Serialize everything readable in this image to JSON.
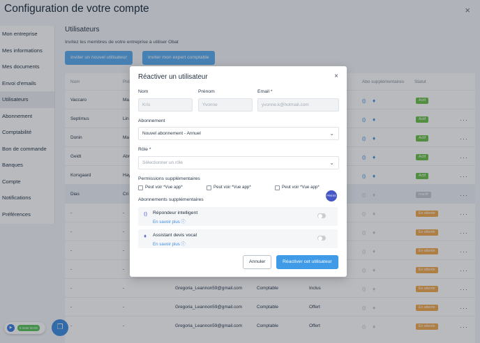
{
  "page": {
    "title": "Configuration de votre compte",
    "close": "×"
  },
  "sidebar": {
    "items": [
      {
        "label": "Mon entreprise"
      },
      {
        "label": "Mes informations"
      },
      {
        "label": "Mes documents"
      },
      {
        "label": "Envoi d'emails"
      },
      {
        "label": "Utilisateurs"
      },
      {
        "label": "Abonnement"
      },
      {
        "label": "Comptabilité"
      },
      {
        "label": "Bon de commande"
      },
      {
        "label": "Banques"
      },
      {
        "label": "Compte"
      },
      {
        "label": "Notifications"
      },
      {
        "label": "Préférences"
      }
    ],
    "active_index": 4
  },
  "users_section": {
    "title": "Utilisateurs",
    "subtitle": "Invitez les membres de votre entreprise à utiliser Obat",
    "invite_user_label": "Inviter un nouvel utilisateur",
    "invite_expert_label": "Inviter mon expert comptable"
  },
  "table": {
    "headers": {
      "nom": "Nom",
      "prenom": "Pré",
      "abo": "Abo supplémentaires",
      "statut": "Statut"
    },
    "rows": [
      {
        "nom": "Vaccaro",
        "prenom": "Ma",
        "email": "",
        "role": "",
        "abo": "",
        "statut": "Actif"
      },
      {
        "nom": "Septimus",
        "prenom": "Lin",
        "email": "",
        "role": "",
        "abo": "",
        "statut": "Actif"
      },
      {
        "nom": "Donin",
        "prenom": "Ma",
        "email": "",
        "role": "",
        "abo": "",
        "statut": "Actif"
      },
      {
        "nom": "Geidt",
        "prenom": "Abr",
        "email": "",
        "role": "",
        "abo": "",
        "statut": "Actif"
      },
      {
        "nom": "Korsgaard",
        "prenom": "Hay",
        "email": "",
        "role": "",
        "abo": "",
        "statut": "Actif"
      },
      {
        "nom": "Dias",
        "prenom": "Cri",
        "email": "",
        "role": "",
        "abo": "",
        "statut": "Inactif"
      },
      {
        "nom": "-",
        "prenom": "-",
        "email": "",
        "role": "",
        "abo": "",
        "statut": "En attente"
      },
      {
        "nom": "-",
        "prenom": "-",
        "email": "",
        "role": "",
        "abo": "",
        "statut": "En attente"
      },
      {
        "nom": "-",
        "prenom": "-",
        "email": "",
        "role": "",
        "abo": "",
        "statut": "En attente"
      },
      {
        "nom": "-",
        "prenom": "-",
        "email": "",
        "role": "",
        "abo": "",
        "statut": "En attente"
      },
      {
        "nom": "-",
        "prenom": "-",
        "email": "Gregoria_Leannon59@gmail.com",
        "role": "Comptable",
        "abo": "Inclus",
        "statut": "En attente"
      },
      {
        "nom": "-",
        "prenom": "-",
        "email": "Gregoria_Leannon59@gmail.com",
        "role": "Comptable",
        "abo": "Offert",
        "statut": "En attente"
      },
      {
        "nom": "-",
        "prenom": "-",
        "email": "Gregoria_Leannon59@gmail.com",
        "role": "Comptable",
        "abo": "Offert",
        "statut": "En attente"
      }
    ],
    "more": "···"
  },
  "modal": {
    "title": "Réactiver un utilisateur",
    "close": "×",
    "nom_label": "Nom",
    "nom_value": "Kris",
    "prenom_label": "Prénom",
    "prenom_value": "Yvonne",
    "email_label": "Email *",
    "email_value": "yvonne.k@hotmail.com",
    "abonnement_label": "Abonnement",
    "abonnement_value": "Nouvel abonnement - Annuel",
    "role_label": "Rôle *",
    "role_placeholder": "Sélectionner un rôle",
    "permissions_label": "Permissions supplémentaires",
    "permissions": [
      {
        "label": "Peut voir *Vue app*"
      },
      {
        "label": "Peut voir *Vue app*"
      },
      {
        "label": "Peut voir *Vue app*"
      }
    ],
    "new_badge": "PRESS",
    "addons_label": "Abonnements supplémentaires",
    "addons": [
      {
        "title": "Répondeur intelligent",
        "link": "En savoir plus ⓘ"
      },
      {
        "title": "Assistant devis vocal",
        "link": "En savoir plus ⓘ"
      }
    ],
    "cancel_label": "Annuler",
    "submit_label": "Réactiver cet utilisateur"
  },
  "widgets": {
    "timer": "Il reste 00:00",
    "play": "▶",
    "chat": "❐"
  },
  "colors": {
    "accent": "#3f9ae8",
    "actif": "#6cc04a",
    "inactif": "#c4c9cf",
    "attente": "#f2a94f",
    "addon_icon": "#5c6bd6"
  }
}
